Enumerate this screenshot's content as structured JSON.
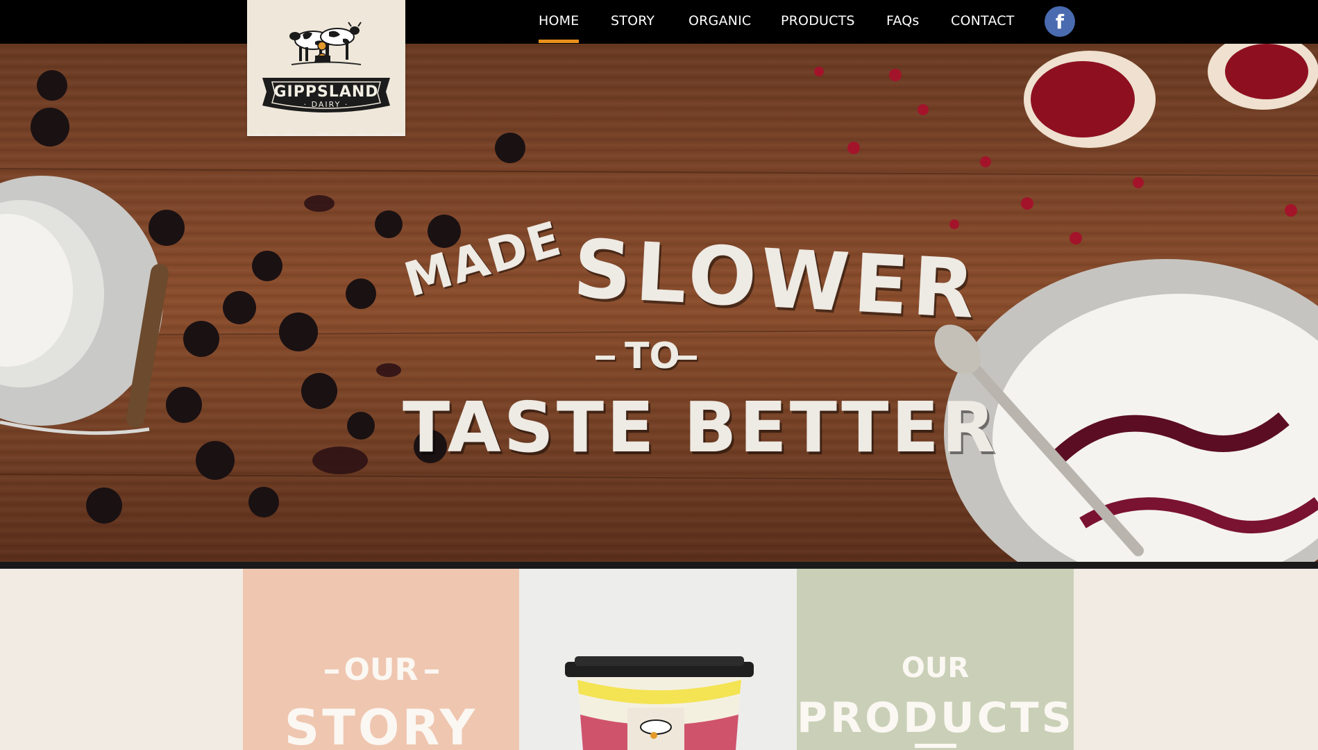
{
  "brand": {
    "logo_text": "GIPPSLAND",
    "logo_subtext": "· DAIRY ·"
  },
  "nav": {
    "items": [
      {
        "label": "HOME",
        "active": true
      },
      {
        "label": "STORY",
        "active": false
      },
      {
        "label": "ORGANIC",
        "active": false
      },
      {
        "label": "PRODUCTS",
        "active": false
      },
      {
        "label": "FAQs",
        "active": false
      },
      {
        "label": "CONTACT",
        "active": false
      }
    ],
    "facebook_icon": "facebook-icon",
    "facebook_glyph": "f",
    "active_color": "#e8901c"
  },
  "hero": {
    "line1": "MADE",
    "line2": "SLOWER",
    "line3": "TO",
    "line4": "TASTE BETTER"
  },
  "panels": {
    "story": {
      "top": "OUR",
      "bottom": "STORY",
      "color": "#efc6b0"
    },
    "product_image": {
      "color": "#ededec"
    },
    "products": {
      "top": "OUR",
      "bottom": "PRODUCTS",
      "color": "#c9d0b7"
    }
  }
}
